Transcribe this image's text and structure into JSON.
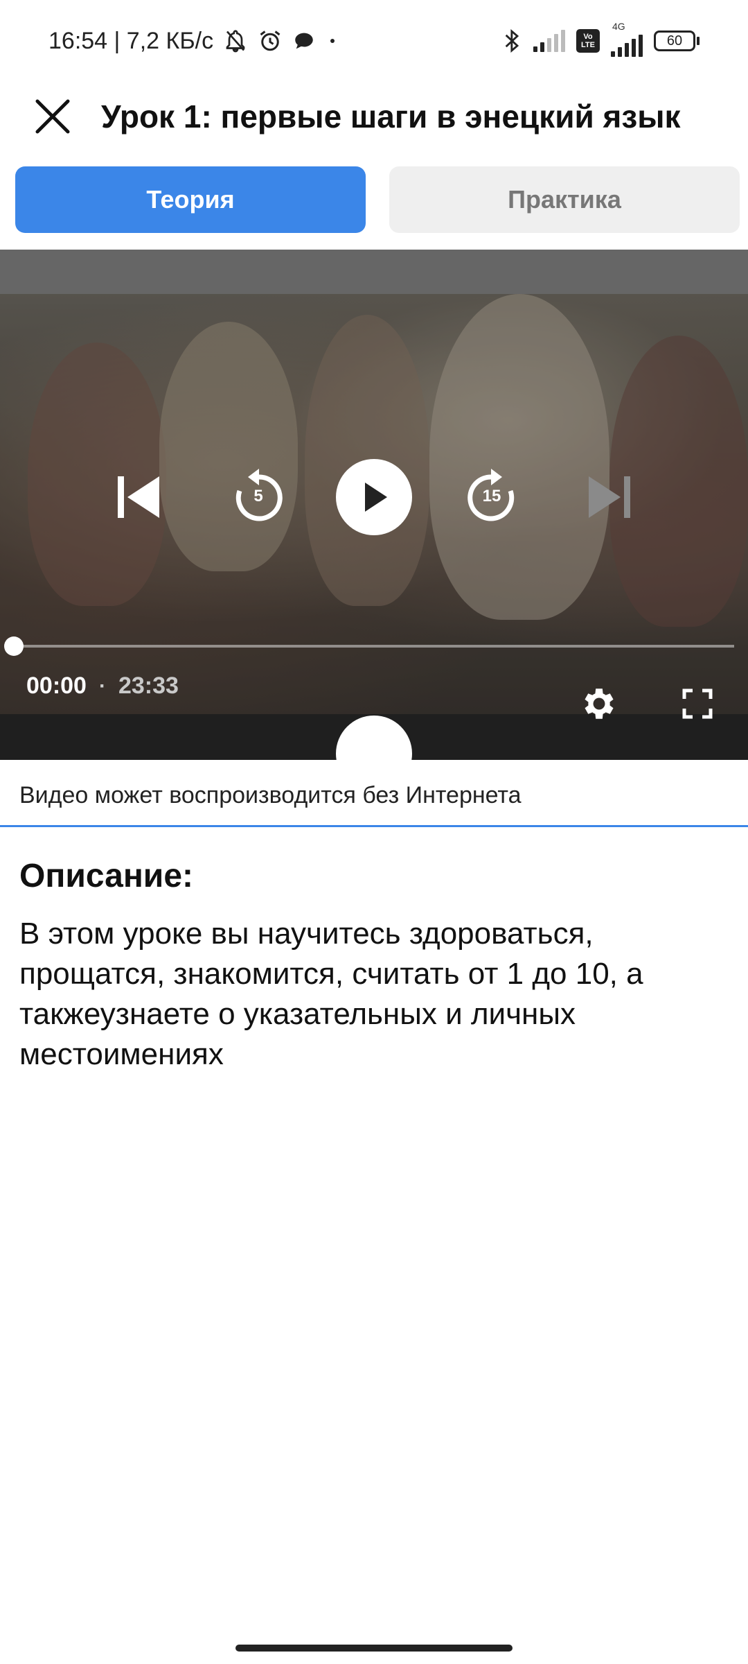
{
  "status_bar": {
    "time_and_speed": "16:54 | 7,2 КБ/с",
    "net_tag": "4G",
    "volte_top": "Vo",
    "volte_bottom": "LTE",
    "battery": "60"
  },
  "header": {
    "title": "Урок 1: первые шаги в энецкий язык"
  },
  "tabs": [
    {
      "label": "Теория",
      "active": true
    },
    {
      "label": "Практика",
      "active": false
    }
  ],
  "player": {
    "rewind_seconds": "5",
    "forward_seconds": "15",
    "current_time": "00:00",
    "separator": "·",
    "duration": "23:33",
    "progress_fraction": 0.0
  },
  "offline_note": "Видео может воспроизводится без Интернета",
  "description": {
    "heading": "Описание:",
    "text": "В этом уроке вы научитесь здороваться, прощатся, знакомится, считать от 1 до 10, а такжеузнаете о указательных и личных местоимениях"
  },
  "colors": {
    "accent": "#3b86e8",
    "tab_inactive_bg": "#efefef",
    "tab_inactive_text": "#777777"
  }
}
